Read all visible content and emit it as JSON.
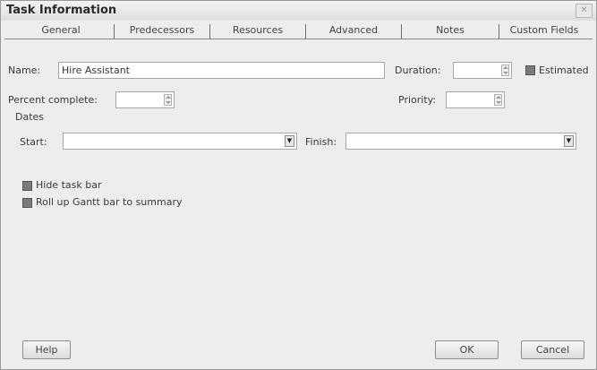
{
  "window": {
    "title": "Task Information"
  },
  "tabs": [
    {
      "label": "General"
    },
    {
      "label": "Predecessors"
    },
    {
      "label": "Resources"
    },
    {
      "label": "Advanced"
    },
    {
      "label": "Notes"
    },
    {
      "label": "Custom Fields"
    }
  ],
  "fields": {
    "name_label": "Name:",
    "name_value": "Hire Assistant",
    "duration_label": "Duration:",
    "duration_value": "",
    "estimated_label": "Estimated",
    "percent_label": "Percent complete:",
    "percent_value": "",
    "priority_label": "Priority:",
    "priority_value": ""
  },
  "dates": {
    "group_label": "Dates",
    "start_label": "Start:",
    "start_value": "",
    "finish_label": "Finish:",
    "finish_value": ""
  },
  "options": {
    "hide_task_bar_label": "Hide task bar",
    "rollup_label": "Roll up Gantt bar to summary"
  },
  "buttons": {
    "help": "Help",
    "ok": "OK",
    "cancel": "Cancel"
  }
}
